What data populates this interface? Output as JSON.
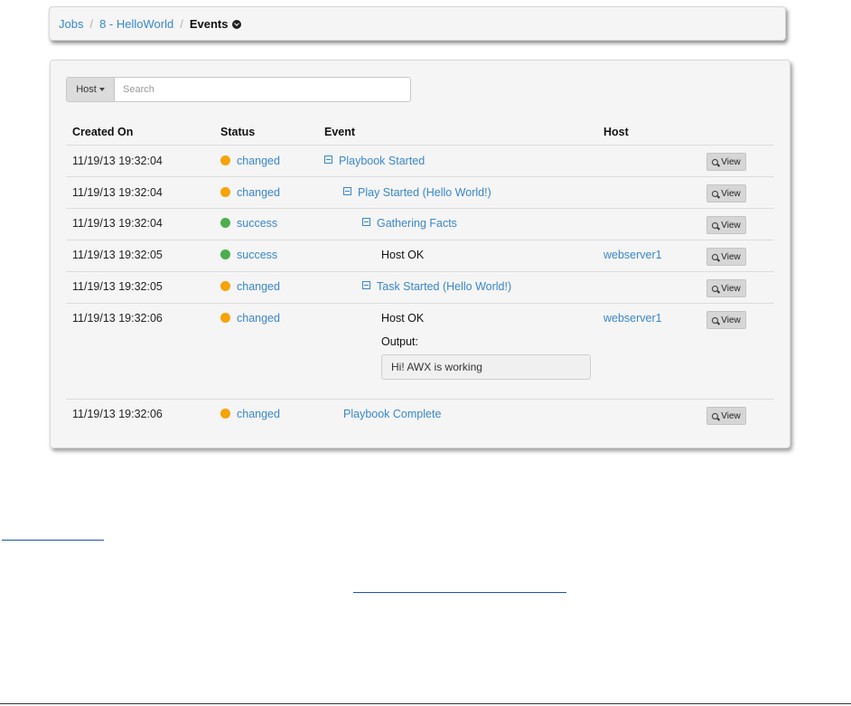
{
  "breadcrumb": {
    "items": [
      "Jobs",
      "8 - HelloWorld"
    ],
    "separator": "/",
    "current": "Events"
  },
  "search": {
    "dropdown_label": "Host",
    "placeholder": "Search",
    "value": ""
  },
  "table": {
    "headers": {
      "created_on": "Created On",
      "status": "Status",
      "event": "Event",
      "host": "Host"
    },
    "view_label": "View",
    "rows": [
      {
        "created": "11/19/13 19:32:04",
        "status": "changed",
        "event": "Playbook Started",
        "host": ""
      },
      {
        "created": "11/19/13 19:32:04",
        "status": "changed",
        "event": "Play Started (Hello World!)",
        "host": ""
      },
      {
        "created": "11/19/13 19:32:04",
        "status": "success",
        "event": "Gathering Facts",
        "host": ""
      },
      {
        "created": "11/19/13 19:32:05",
        "status": "success",
        "event": "Host OK",
        "host": "webserver1"
      },
      {
        "created": "11/19/13 19:32:05",
        "status": "changed",
        "event": "Task Started (Hello World!)",
        "host": ""
      },
      {
        "created": "11/19/13 19:32:06",
        "status": "changed",
        "event": "Host OK",
        "host": "webserver1",
        "output_label": "Output:",
        "output": "Hi! AWX is working"
      },
      {
        "created": "11/19/13 19:32:06",
        "status": "changed",
        "event": "Playbook Complete",
        "host": ""
      }
    ]
  },
  "colors": {
    "changed": "#f5a30a",
    "success": "#4cae4c",
    "link": "#3a87c8"
  },
  "icons": {
    "breadcrumb_current": "chevron-circle-down-icon",
    "collapse": "minus-square-icon",
    "view": "magnifier-icon"
  }
}
